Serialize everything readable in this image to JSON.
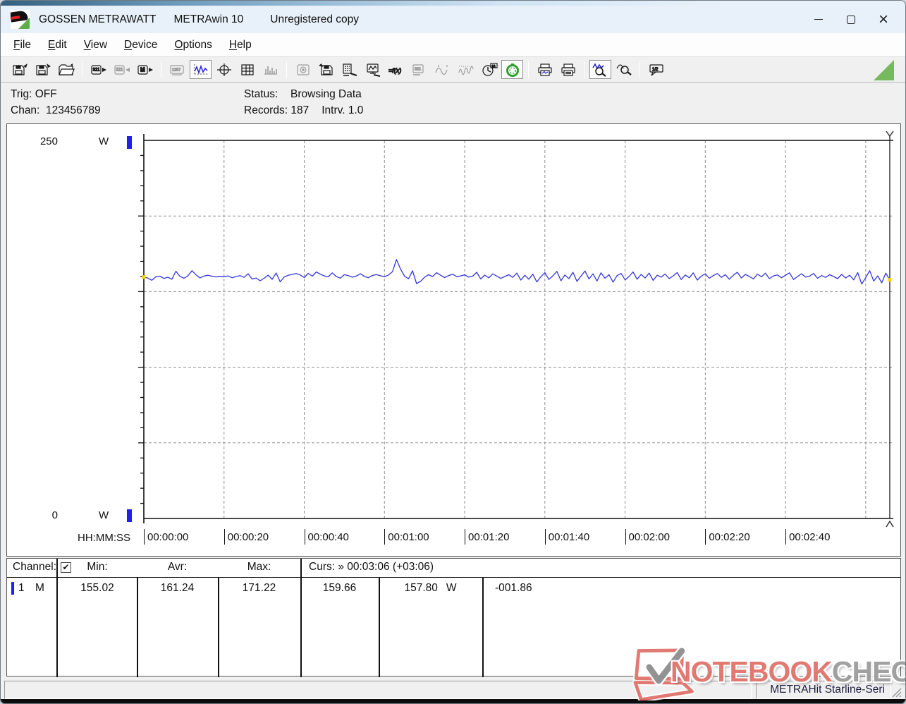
{
  "window": {
    "app": "GOSSEN METRAWATT",
    "product": "METRAwin 10",
    "license": "Unregistered copy"
  },
  "menu": {
    "items": [
      {
        "label": "File"
      },
      {
        "label": "Edit"
      },
      {
        "label": "View"
      },
      {
        "label": "Device"
      },
      {
        "label": "Options"
      },
      {
        "label": "Help"
      }
    ]
  },
  "toolbar": {
    "groups": [
      [
        {
          "name": "save-data",
          "kind": "floppy_out",
          "state": "normal"
        },
        {
          "name": "save-data-as",
          "kind": "floppy_in",
          "state": "normal"
        },
        {
          "name": "open-file",
          "kind": "folder",
          "state": "normal"
        }
      ],
      [
        {
          "name": "read-from-device",
          "kind": "dev_out",
          "state": "normal"
        },
        {
          "name": "send-to-device",
          "kind": "dev_in",
          "state": "disabled"
        },
        {
          "name": "read-device-memory",
          "kind": "dev_m",
          "state": "normal"
        }
      ],
      [
        {
          "name": "online-display",
          "kind": "display",
          "state": "disabled"
        },
        {
          "name": "chart-view",
          "kind": "wave",
          "state": "active"
        },
        {
          "name": "xy-view",
          "kind": "crosshair",
          "state": "normal"
        },
        {
          "name": "table-view",
          "kind": "table",
          "state": "normal"
        },
        {
          "name": "histogram-view",
          "kind": "bars",
          "state": "disabled"
        }
      ],
      [
        {
          "name": "export-data",
          "kind": "disk",
          "state": "disabled"
        },
        {
          "name": "save-configuration",
          "kind": "floppy_cfg",
          "state": "normal"
        },
        {
          "name": "channel-setup",
          "kind": "chanlist",
          "state": "normal"
        },
        {
          "name": "display-setup",
          "kind": "monitor",
          "state": "normal"
        },
        {
          "name": "formula",
          "kind": "fx",
          "state": "normal"
        },
        {
          "name": "device-setup",
          "kind": "display2",
          "state": "disabled"
        },
        {
          "name": "curve-overlay",
          "kind": "sine",
          "state": "disabled"
        },
        {
          "name": "curve-compress",
          "kind": "sines",
          "state": "disabled"
        },
        {
          "name": "time-setup",
          "kind": "clock",
          "state": "normal"
        },
        {
          "name": "interval-timer",
          "kind": "timer",
          "state": "active"
        }
      ],
      [
        {
          "name": "print-preview",
          "kind": "printprev",
          "state": "normal"
        },
        {
          "name": "print",
          "kind": "printer",
          "state": "normal"
        }
      ],
      [
        {
          "name": "zoom-horizontal",
          "kind": "zoomwave",
          "state": "active"
        },
        {
          "name": "zoom-vertical",
          "kind": "zoomout",
          "state": "normal"
        }
      ],
      [
        {
          "name": "annotation",
          "kind": "note",
          "state": "normal"
        }
      ]
    ]
  },
  "status_panel": {
    "trig_label": "Trig:",
    "trig_value": "OFF",
    "chan_label": "Chan:",
    "chan_value": "123456789",
    "status_label": "Status:",
    "status_value": "Browsing Data",
    "records_label": "Records:",
    "records_value": "187",
    "interval_label": "Intrv.",
    "interval_value": "1.0"
  },
  "chart_data": {
    "type": "line",
    "unit": "W",
    "y_max_label": "250",
    "y_min_label": "0",
    "ylim": [
      0,
      250
    ],
    "y_gridlines": [
      50,
      100,
      150,
      200
    ],
    "time_format_label": "HH:MM:SS",
    "x_ticks": [
      "00:00:00",
      "00:00:20",
      "00:00:40",
      "00:01:00",
      "00:01:20",
      "00:01:40",
      "00:02:00",
      "00:02:20",
      "00:02:40"
    ],
    "x_interval_seconds": 1,
    "records": 187,
    "cursor": {
      "time": "00:03:06",
      "delta": "+03:06",
      "value_start": 159.66,
      "value_end": 157.8,
      "difference": -1.86
    },
    "stats": {
      "min": 155.02,
      "avr": 161.24,
      "max": 171.22
    },
    "series": [
      {
        "name": "Channel 1 power",
        "color": "#3434e0",
        "values": [
          159.66,
          158.9,
          157.5,
          159.8,
          160.2,
          158.7,
          159.5,
          158.2,
          163.5,
          160.1,
          158.8,
          160.5,
          163.8,
          161.2,
          159.0,
          160.3,
          160.8,
          160.2,
          159.7,
          160.1,
          159.9,
          160.4,
          159.2,
          160.0,
          160.6,
          159.4,
          161.8,
          158.3,
          159.0,
          157.2,
          158.8,
          160.9,
          158.1,
          162.3,
          156.5,
          159.7,
          160.8,
          161.4,
          162.0,
          161.0,
          159.3,
          162.1,
          160.2,
          163.0,
          161.5,
          160.4,
          159.8,
          162.4,
          160.0,
          158.9,
          161.2,
          160.6,
          159.5,
          160.3,
          161.8,
          160.1,
          159.2,
          160.7,
          161.3,
          160.5,
          159.8,
          161.0,
          163.2,
          171.22,
          165.0,
          160.2,
          158.5,
          163.8,
          155.3,
          156.8,
          159.5,
          161.2,
          160.0,
          162.5,
          160.8,
          159.3,
          160.6,
          161.5,
          159.9,
          160.4,
          161.1,
          159.6,
          160.2,
          162.8,
          158.4,
          160.9,
          159.1,
          161.7,
          160.3,
          158.7,
          160.0,
          161.2,
          159.4,
          162.2,
          157.6,
          160.8,
          158.2,
          161.5,
          156.4,
          159.8,
          162.6,
          158.0,
          160.5,
          163.4,
          157.2,
          161.0,
          158.6,
          162.8,
          156.8,
          160.2,
          163.6,
          158.4,
          161.8,
          157.0,
          162.4,
          158.8,
          161.2,
          156.2,
          160.6,
          162.0,
          157.8,
          160.0,
          163.0,
          158.2,
          161.4,
          159.0,
          162.2,
          157.4,
          160.8,
          159.6,
          161.6,
          158.6,
          160.4,
          162.6,
          158.0,
          161.0,
          159.2,
          162.4,
          157.6,
          160.2,
          161.8,
          158.8,
          160.6,
          162.0,
          159.4,
          161.2,
          158.2,
          160.8,
          162.8,
          159.0,
          161.4,
          160.0,
          158.4,
          161.6,
          159.8,
          162.2,
          158.6,
          160.4,
          161.0,
          159.2,
          160.8,
          162.4,
          158.0,
          160.0,
          161.8,
          159.6,
          160.2,
          162.0,
          158.8,
          160.6,
          159.4,
          161.2,
          160.0,
          158.6,
          161.4,
          159.0,
          160.8,
          157.8,
          162.6,
          155.02,
          159.2,
          163.8,
          157.0,
          160.4,
          155.8,
          162.2,
          157.8
        ]
      }
    ]
  },
  "table": {
    "header": {
      "channel": "Channel:",
      "min": "Min:",
      "avr": "Avr:",
      "max": "Max:",
      "cursor": "Curs: » 00:03:06 (+03:06)",
      "checkbox_checked": "✔"
    },
    "row": {
      "channel_num": "1",
      "channel_mode": "M",
      "min": "155.02",
      "avr": "161.24",
      "max": "171.22",
      "cursor_start": "159.66",
      "cursor_end": "157.80",
      "unit": "W",
      "delta": "-001.86"
    }
  },
  "watermark": {
    "primary": "NOTEBOOK",
    "secondary": "CHECK"
  },
  "status_bar": {
    "device": "METRAHit Starline-Seri"
  },
  "colors": {
    "trace": "#3434e0",
    "marker_blue": "#2020ee",
    "cursor_dot": "#ffd400",
    "watermark_red": "#e0736c",
    "watermark_gray": "#9c9c9c",
    "timer_green": "#2f9e2f",
    "corner_green": "#77b95d"
  }
}
